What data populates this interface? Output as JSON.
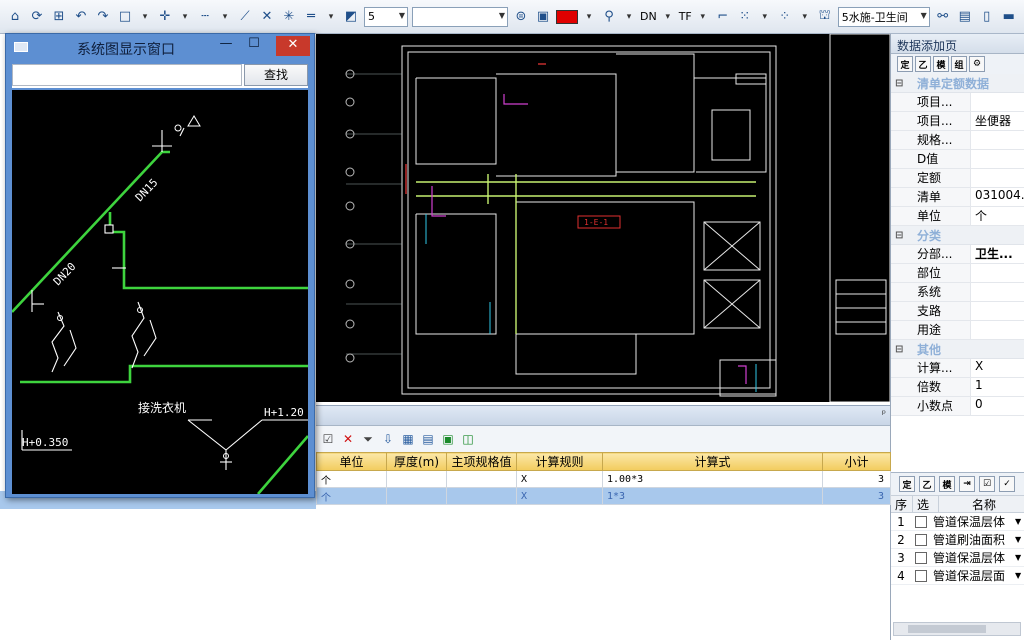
{
  "toolbar": {
    "line_width_value": "5",
    "layer_combo_value": "",
    "system_combo_value": "5水施-卫生间",
    "dn_label": "DN",
    "tf_label": "TF",
    "accent_color": "#e00000"
  },
  "floating_window": {
    "title": "系统图显示窗口",
    "search_value": "",
    "find_button": "查找",
    "minimize": "—",
    "maximize": "☐",
    "close": "✕",
    "labels": {
      "dn15": "DN15",
      "dn20": "DN20",
      "washer": "接洗衣机",
      "h_left": "H+0.350",
      "h_right": "H+1.20"
    }
  },
  "cad": {
    "tag_label": "1-E-1"
  },
  "right_panel": {
    "title": "数据添加页",
    "tool_buttons": [
      "定",
      "乙",
      "模",
      "组",
      "⚙"
    ],
    "groups": [
      {
        "name": "清单定额数据",
        "rows": [
          {
            "key": "项目...",
            "value": ""
          },
          {
            "key": "项目...",
            "value": "坐便器"
          },
          {
            "key": "规格...",
            "value": ""
          },
          {
            "key": "D值",
            "value": ""
          },
          {
            "key": "定额",
            "value": ""
          },
          {
            "key": "清单",
            "value": "031004..."
          },
          {
            "key": "单位",
            "value": "个"
          }
        ]
      },
      {
        "name": "分类",
        "rows": [
          {
            "key": "分部...",
            "value": "卫生..."
          },
          {
            "key": "部位",
            "value": ""
          },
          {
            "key": "系统",
            "value": ""
          },
          {
            "key": "支路",
            "value": ""
          },
          {
            "key": "用途",
            "value": ""
          }
        ]
      },
      {
        "name": "其他",
        "rows": [
          {
            "key": "计算...",
            "value": "X"
          },
          {
            "key": "倍数",
            "value": "1"
          },
          {
            "key": "小数点",
            "value": "0"
          }
        ]
      }
    ],
    "lower_tools": [
      "定",
      "乙",
      "模",
      "⇥",
      "☑",
      "✓"
    ],
    "list_headers": {
      "seq": "序",
      "sel": "选",
      "name": "名称"
    },
    "list_items": [
      {
        "seq": "1",
        "name": "管道保温层体"
      },
      {
        "seq": "2",
        "name": "管道刷油面积"
      },
      {
        "seq": "3",
        "name": "管道保温层体"
      },
      {
        "seq": "4",
        "name": "管道保温层面"
      }
    ]
  },
  "bottom_panel": {
    "pin": "ᵖ",
    "headers": [
      "单位",
      "厚度(m)",
      "主项规格值",
      "计算规则",
      "计算式",
      "小计"
    ],
    "rows": [
      {
        "unit": "个",
        "thick": "",
        "spec": "",
        "rule": "X",
        "formula": "1.00*3",
        "subtotal": "3"
      },
      {
        "unit": "个",
        "thick": "",
        "spec": "",
        "rule": "X",
        "formula": "1*3",
        "subtotal": "3"
      }
    ]
  }
}
